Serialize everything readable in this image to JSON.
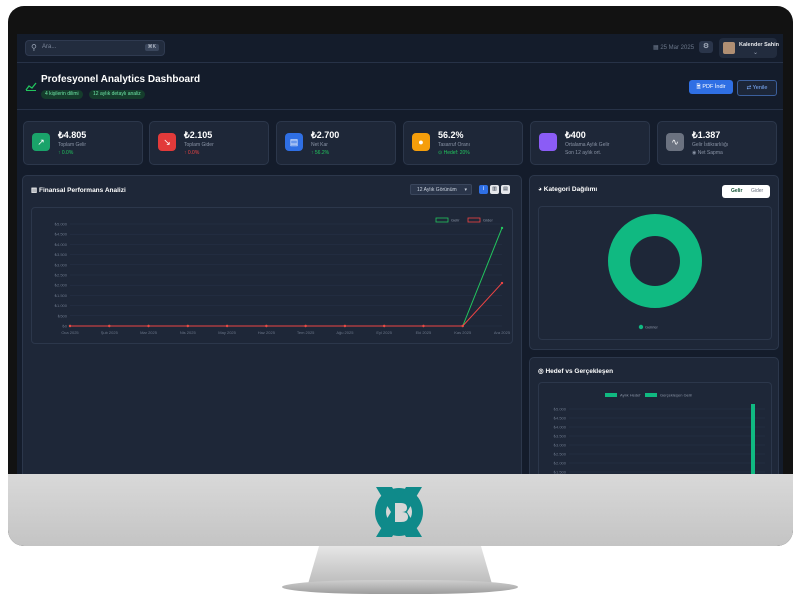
{
  "topbar": {
    "search_placeholder": "Ara...",
    "search_shortcut": "⌘K",
    "date": "25 Mar 2025",
    "user_name": "Kalender Sahin"
  },
  "header": {
    "title": "Profesyonel Analytics Dashboard",
    "badges": [
      "4 kişilerin dilimi",
      "12 aylık detaylı analiz"
    ],
    "pdf_button": "PDF İndir",
    "refresh_button": "Yenile"
  },
  "cards": [
    {
      "value": "₺4.805",
      "label": "Toplam Gelir",
      "change": "↑ 0.0%",
      "color": "#1aa36a",
      "icon": "trend-up-icon"
    },
    {
      "value": "₺2.105",
      "label": "Toplam Gider",
      "change": "↑ 0.0%",
      "color": "#e23a3a",
      "icon": "trend-down-icon"
    },
    {
      "value": "₺2.700",
      "label": "Net Kar",
      "change": "↑ 56.2%",
      "color": "#2f6fe4",
      "icon": "money-icon"
    },
    {
      "value": "56.2%",
      "label": "Tasarruf Oranı",
      "change": "⊙ Hedef: 20%",
      "color": "#f59e0b",
      "icon": "piggy-bank-icon"
    },
    {
      "value": "₺400",
      "label": "Ortalama Aylık Gelir",
      "change": "Son 12 aylık ort.",
      "color": "#8b5cf6",
      "icon": "calendar-icon"
    },
    {
      "value": "₺1.387",
      "label": "Gelir İstikrarlılığı",
      "change": "◉ Net Sapma",
      "color": "#6b7280",
      "icon": "wave-icon"
    }
  ],
  "performance": {
    "title": "Finansal Performans Analizi",
    "period_select": "12 Aylık Görünüm"
  },
  "category": {
    "title": "Kategori Dağılımı",
    "tabs": [
      "Gelir",
      "Gider"
    ],
    "legend": "Gelirler"
  },
  "target": {
    "title": "Hedef vs Gerçekleşen"
  },
  "chart_data": [
    {
      "type": "line",
      "categories": [
        "Oca 2025",
        "Şub 2025",
        "Mar 2025",
        "Nis 2025",
        "May 2025",
        "Haz 2025",
        "Tem 2025",
        "Ağu 2025",
        "Eyl 2025",
        "Eki 2025",
        "Kas 2025",
        "Ara 2025"
      ],
      "series": [
        {
          "name": "Gelir",
          "color": "#22c55e",
          "values": [
            0,
            0,
            0,
            0,
            0,
            0,
            0,
            0,
            0,
            0,
            0,
            4805
          ]
        },
        {
          "name": "Gider",
          "color": "#ef4444",
          "values": [
            0,
            0,
            0,
            0,
            0,
            0,
            0,
            0,
            0,
            0,
            0,
            2105
          ]
        }
      ],
      "yticks": [
        "₺0",
        "₺500",
        "₺1.000",
        "₺1.500",
        "₺2.000",
        "₺2.500",
        "₺3.000",
        "₺3.500",
        "₺4.000",
        "₺4.500",
        "₺5.000"
      ],
      "ylim": [
        0,
        5000
      ],
      "grid": true,
      "legend": "top-right"
    },
    {
      "type": "pie",
      "donut": true,
      "labels": [
        "Gelirler"
      ],
      "values": [
        100
      ],
      "colors": [
        "#10b981"
      ]
    },
    {
      "type": "bar",
      "series": [
        {
          "name": "Aylık Hedef",
          "color": "#10b981"
        },
        {
          "name": "Gerçekleşen Gelir",
          "color": "#10b981"
        }
      ],
      "yticks": [
        "₺5.000",
        "₺4.500",
        "₺4.000",
        "₺3.500",
        "₺3.000",
        "₺2.500",
        "₺2.000",
        "₺1.500"
      ],
      "ylim": [
        0,
        5000
      ],
      "legend": "top"
    }
  ]
}
